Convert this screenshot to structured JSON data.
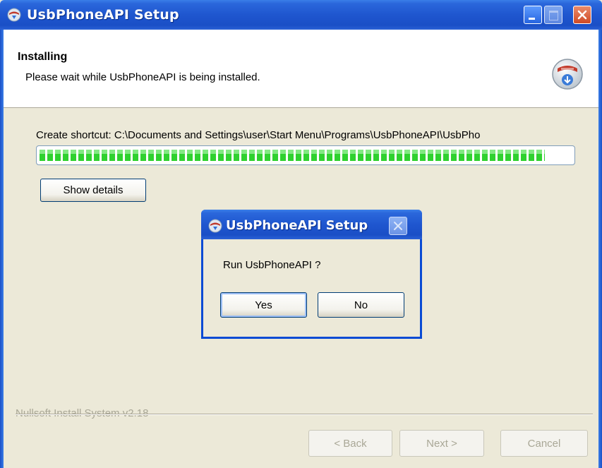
{
  "window": {
    "title": "UsbPhoneAPI Setup",
    "icon": "installer-globe-icon",
    "controls": [
      "minimize-icon",
      "maximize-icon",
      "close-icon"
    ]
  },
  "header": {
    "title": "Installing",
    "subtitle": "Please wait while UsbPhoneAPI is being installed.",
    "icon": "install-disc-icon"
  },
  "progress": {
    "status_text": "Create shortcut: C:\\Documents and Settings\\user\\Start Menu\\Programs\\UsbPhoneAPI\\UsbPho",
    "fraction": 0.95,
    "color": "#2fd12f"
  },
  "buttons": {
    "show_details": "Show details",
    "back": "< Back",
    "next": "Next >",
    "cancel": "Cancel"
  },
  "footer": {
    "branding": "Nullsoft Install System v2.18"
  },
  "dialog": {
    "title": "UsbPhoneAPI Setup",
    "message": "Run UsbPhoneAPI ?",
    "yes": "Yes",
    "no": "No"
  },
  "colors": {
    "titlebar": "#1f56cf",
    "face": "#ece9d8",
    "accent_border": "#003c74"
  }
}
